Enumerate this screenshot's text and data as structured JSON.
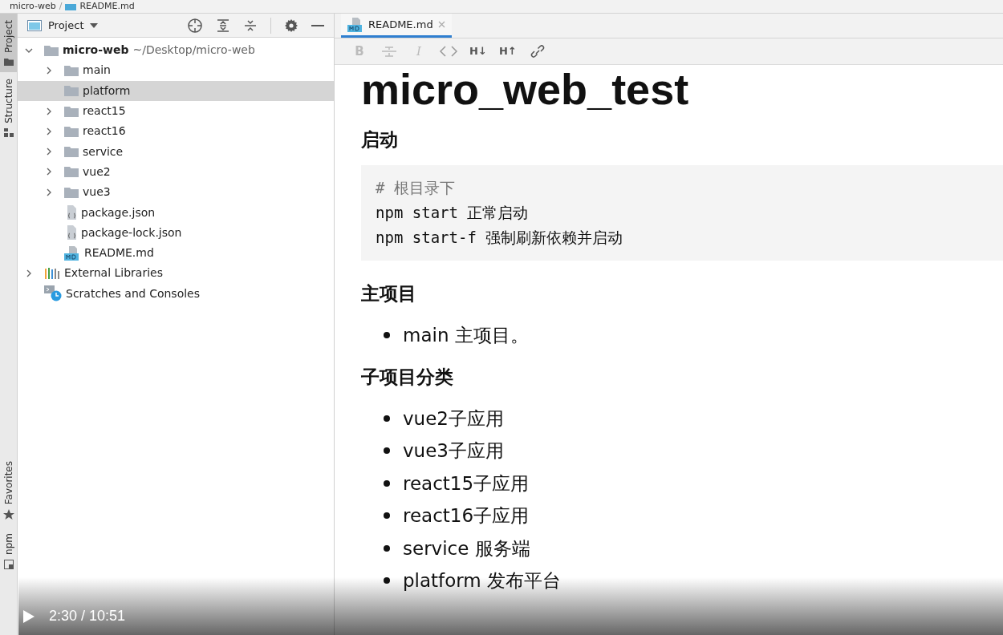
{
  "breadcrumb": [
    {
      "kind": "item",
      "text": "micro-web"
    },
    {
      "kind": "separator",
      "text": "/"
    },
    {
      "kind": "file",
      "text": "README.md"
    }
  ],
  "side_tabs_top": [
    {
      "label": "Project",
      "selected": true,
      "kind": "folder"
    },
    {
      "label": "Structure",
      "selected": false,
      "kind": "structure"
    }
  ],
  "side_tabs_bottom": [
    {
      "label": "Favorites",
      "selected": false,
      "kind": "star"
    },
    {
      "label": "npm",
      "selected": false,
      "kind": "npm"
    }
  ],
  "project_panel": {
    "view": "Project",
    "tree": [
      {
        "label": "micro-web",
        "path": "~/Desktop/micro-web",
        "kind": "root",
        "expanded": true,
        "selected": false,
        "children": [
          {
            "label": "main",
            "kind": "folder",
            "expanded": false,
            "selected": false
          },
          {
            "label": "platform",
            "kind": "empty-folder",
            "selected": true
          },
          {
            "label": "react15",
            "kind": "folder",
            "expanded": false,
            "selected": false
          },
          {
            "label": "react16",
            "kind": "folder",
            "expanded": false,
            "selected": false
          },
          {
            "label": "service",
            "kind": "folder",
            "expanded": false,
            "selected": false
          },
          {
            "label": "vue2",
            "kind": "folder",
            "expanded": false,
            "selected": false
          },
          {
            "label": "vue3",
            "kind": "folder",
            "expanded": false,
            "selected": false
          },
          {
            "label": "package.json",
            "kind": "json",
            "selected": false
          },
          {
            "label": "package-lock.json",
            "kind": "json",
            "selected": false
          },
          {
            "label": "README.md",
            "kind": "md",
            "selected": false
          }
        ]
      },
      {
        "label": "External Libraries",
        "kind": "libraries",
        "expanded": false,
        "selected": false
      },
      {
        "label": "Scratches and Consoles",
        "kind": "scratches",
        "selected": false
      }
    ]
  },
  "editor_tabs": [
    {
      "label": "README.md",
      "selected": true
    }
  ],
  "markdown_toolbar": [
    {
      "kind": "bold",
      "label": "B"
    },
    {
      "kind": "strike"
    },
    {
      "kind": "italic",
      "label": "I"
    },
    {
      "kind": "code"
    },
    {
      "kind": "heading-down",
      "label": "H↓"
    },
    {
      "kind": "heading-up",
      "label": "H↑"
    },
    {
      "kind": "link"
    }
  ],
  "document": [
    {
      "kind": "h1",
      "text": "micro_web_test"
    },
    {
      "kind": "h2",
      "text": "启动"
    },
    {
      "kind": "code",
      "lines": [
        {
          "kind": "comment",
          "text": "# 根目录下"
        },
        {
          "kind": "plain",
          "text": "npm start 正常启动"
        },
        {
          "kind": "plain",
          "text": "npm start-f 强制刷新依赖并启动"
        }
      ]
    },
    {
      "kind": "h2",
      "text": "主项目"
    },
    {
      "kind": "list",
      "items": [
        "main 主项目。"
      ]
    },
    {
      "kind": "h2",
      "text": "子项目分类"
    },
    {
      "kind": "list",
      "items": [
        "vue2子应用",
        "vue3子应用",
        "react15子应用",
        "react16子应用",
        "service 服务端",
        "platform 发布平台"
      ]
    }
  ],
  "player": {
    "time": "2:30 / 10:51"
  }
}
